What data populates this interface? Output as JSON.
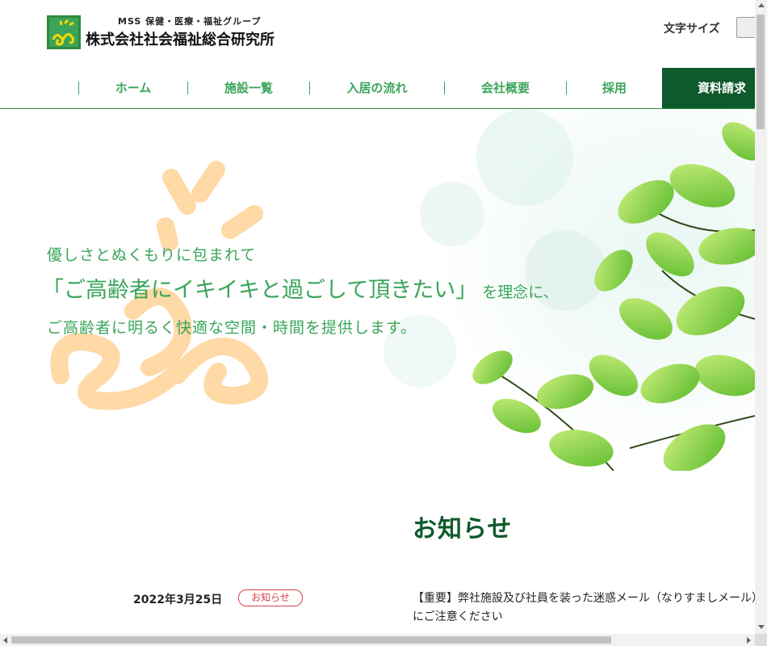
{
  "header": {
    "logo_subtitle": "MSS 保健・医療・福祉グループ",
    "logo_name": "株式会社社会福祉総合研究所",
    "text_size_label": "文字サイズ"
  },
  "nav": {
    "items": [
      {
        "label": "ホーム"
      },
      {
        "label": "施設一覧"
      },
      {
        "label": "入居の流れ"
      },
      {
        "label": "会社概要"
      },
      {
        "label": "採用"
      }
    ],
    "cta_label": "資料請求"
  },
  "hero": {
    "line1": "優しさとぬくもりに包まれて",
    "line2": "「ご高齢者にイキイキと過ごして頂きたい」",
    "line2_suffix": "を理念に、",
    "line3": "ご高齢者に明るく快適な空間・時間を提供します。"
  },
  "news": {
    "title": "お知らせ",
    "items": [
      {
        "date": "2022年3月25日",
        "tag": "お知らせ",
        "text": "【重要】弊社施設及び社員を装った迷惑メール（なりすましメール）にご注意ください"
      }
    ]
  },
  "colors": {
    "brand_green": "#3aa55a",
    "dark_green": "#0f5a2c",
    "tag_red": "#d9414b",
    "motif_orange": "#ffd7a0"
  }
}
